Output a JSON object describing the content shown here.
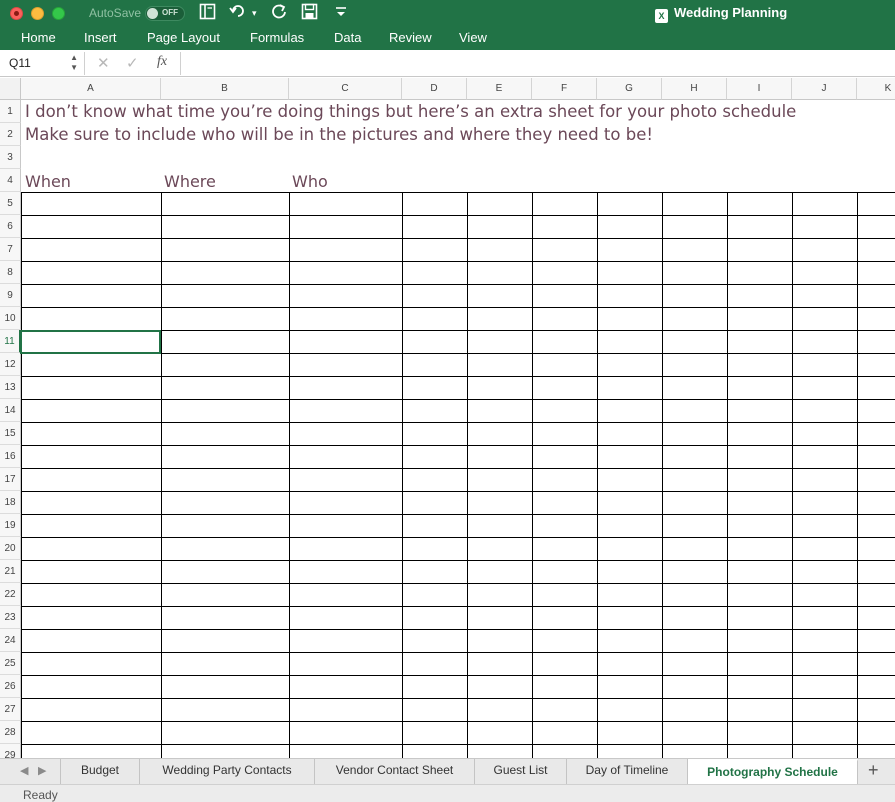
{
  "window": {
    "title": "Wedding Planning",
    "autosave_label": "AutoSave",
    "autosave_state": "OFF",
    "app_badge": "X"
  },
  "ribbon": {
    "tabs": [
      "Home",
      "Insert",
      "Page Layout",
      "Formulas",
      "Data",
      "Review",
      "View"
    ]
  },
  "formula_bar": {
    "name_box": "Q11",
    "fx_label": "fx",
    "formula": ""
  },
  "sheet": {
    "columns": [
      "A",
      "B",
      "C",
      "D",
      "E",
      "F",
      "G",
      "H",
      "I",
      "J",
      "K"
    ],
    "rows": [
      "1",
      "2",
      "3",
      "4",
      "5",
      "6",
      "7",
      "8",
      "9",
      "10",
      "11",
      "12",
      "13",
      "14",
      "15",
      "16",
      "17",
      "18",
      "19",
      "20",
      "21",
      "22",
      "23",
      "24",
      "25",
      "26",
      "27",
      "28",
      "29"
    ],
    "selected_row": "11",
    "line1": "I don’t know what time you’re doing things but here’s an extra sheet for your photo schedule",
    "line2": "Make sure to include who will be in the pictures and where they need to be!",
    "headers": {
      "when": "When",
      "where": "Where",
      "who": "Who"
    }
  },
  "sheet_tabs": [
    "Budget",
    "Wedding Party Contacts",
    "Vendor Contact Sheet",
    "Guest List",
    "Day of Timeline",
    "Photography Schedule"
  ],
  "active_sheet": "Photography Schedule",
  "status": "Ready",
  "colors": {
    "excel_green": "#217346",
    "text_mauve": "#6b4858"
  }
}
